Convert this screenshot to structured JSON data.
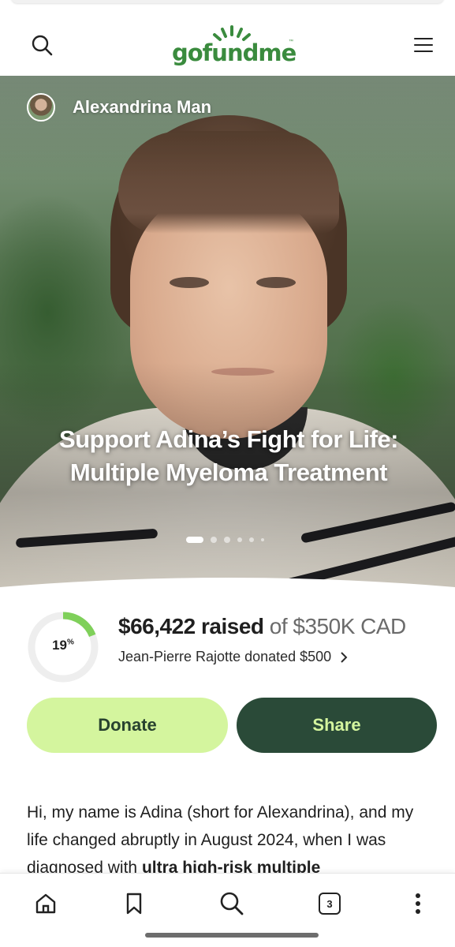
{
  "header": {
    "logo_text": "gofundme",
    "brand_color": "#3a8b3e",
    "search_icon": "search-icon",
    "menu_icon": "hamburger-menu-icon"
  },
  "hero": {
    "organizer_name": "Alexandrina Man",
    "title": "Support Adina’s Fight for Life: Multiple Myeloma Treatment",
    "carousel": {
      "total_dots": 6,
      "active_index": 0
    }
  },
  "progress": {
    "percent": 19,
    "percent_label": "19",
    "percent_sign": "%",
    "raised_amount": "$66,422 raised",
    "goal_text": " of $350K CAD",
    "recent_donation": "Jean-Pierre Rajotte donated $500",
    "ring_color": "#7fd05a",
    "track_color": "#eeeeee"
  },
  "actions": {
    "donate_label": "Donate",
    "share_label": "Share",
    "donate_bg": "#d4f59e",
    "share_bg": "#2a4a38"
  },
  "story": {
    "text_plain": "Hi, my name is Adina (short for Alexandrina), and my life changed abruptly in August 2024, when I was diagnosed with ",
    "text_bold": "ultra high-risk multiple"
  },
  "bottom_nav": {
    "home_icon": "home-icon",
    "bookmark_icon": "bookmark-icon",
    "search_icon": "search-icon",
    "tab_count": "3",
    "more_icon": "more-vertical-icon"
  }
}
